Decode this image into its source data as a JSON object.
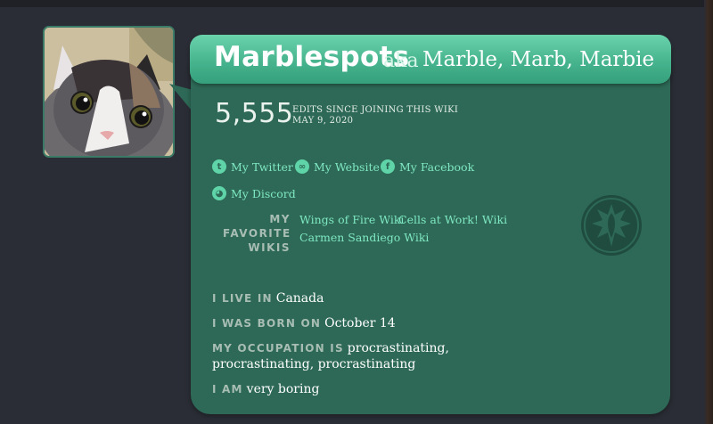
{
  "profile": {
    "username": "Marblespots",
    "aka_label": "aka",
    "nicknames": "Marble, Marb, Marbie",
    "edits_count": "5,555",
    "edits_label": "EDITS SINCE JOINING THIS WIKI",
    "join_date": "MAY 9, 2020"
  },
  "links": {
    "twitter": "My Twitter",
    "website": "My Website",
    "facebook": "My Facebook",
    "discord": "My Discord"
  },
  "favorites": {
    "label_line1": "MY",
    "label_line2": "FAVORITE",
    "label_line3": "WIKIS",
    "wikis": [
      "Wings of Fire Wiki",
      "Cells at Work! Wiki",
      "Carmen Sandiego Wiki"
    ]
  },
  "info": {
    "live_key": "I LIVE IN",
    "live_val": "Canada",
    "born_key": "I WAS BORN ON",
    "born_val": "October 14",
    "occupation_key": "MY OCCUPATION IS",
    "occupation_val_line1": "procrastinating,",
    "occupation_val_line2": "procrastinating, procrastinating",
    "am_key": "I AM",
    "am_val": "very boring"
  },
  "colors": {
    "card": "#2d6956",
    "banner": "#4cbf96",
    "link": "#7fe8c2",
    "label": "#a8bdb4",
    "background": "#2a2d35"
  }
}
